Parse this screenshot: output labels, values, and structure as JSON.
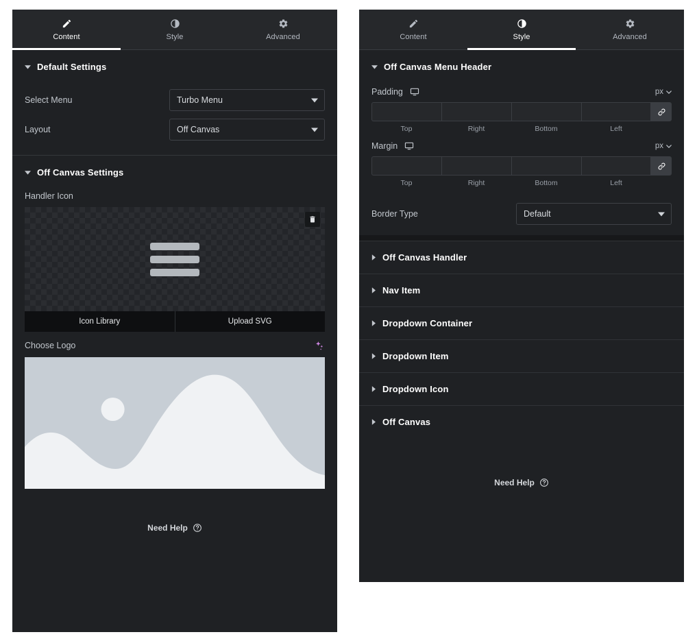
{
  "theme": {
    "panel_bg": "#1f2124",
    "tabbar_bg": "#26282b",
    "accent": "#ffffff",
    "label_color": "#c2c7cd",
    "ai_icon_color": "#d48ae8",
    "placeholder_bg": "#c7ced5",
    "placeholder_fg": "#f0f2f4",
    "burger_color": "#b3b8bd"
  },
  "content_panel": {
    "tabs": [
      {
        "label": "Content",
        "icon": "pencil-icon",
        "active": true
      },
      {
        "label": "Style",
        "icon": "contrast-icon",
        "active": false
      },
      {
        "label": "Advanced",
        "icon": "gear-icon",
        "active": false
      }
    ],
    "sections": [
      {
        "title": "Default Settings",
        "expanded": true,
        "rows": [
          {
            "label": "Select Menu",
            "control": "select",
            "value": "Turbo Menu"
          },
          {
            "label": "Layout",
            "control": "select",
            "value": "Off Canvas"
          }
        ]
      },
      {
        "title": "Off Canvas Settings",
        "expanded": true
      }
    ],
    "handler_icon": {
      "label": "Handler Icon",
      "delete_icon": "trash-icon",
      "preview": "hamburger-bars",
      "buttons": [
        {
          "label": "Icon Library"
        },
        {
          "label": "Upload SVG"
        }
      ]
    },
    "choose_logo": {
      "label": "Choose Logo",
      "ai_icon": "sparkle-ai-icon",
      "preview": "image-placeholder"
    },
    "need_help": {
      "label": "Need Help",
      "icon": "question-circle-icon"
    }
  },
  "style_panel": {
    "tabs": [
      {
        "label": "Content",
        "icon": "pencil-icon",
        "active": false
      },
      {
        "label": "Style",
        "icon": "contrast-icon",
        "active": true
      },
      {
        "label": "Advanced",
        "icon": "gear-icon",
        "active": false
      }
    ],
    "open_section": {
      "title": "Off Canvas Menu Header",
      "dimension_controls": [
        {
          "label": "Padding",
          "device_icon": "desktop-icon",
          "unit": "px",
          "unit_caret": "chevron-down-icon",
          "linked": true,
          "link_icon": "link-icon",
          "sides": [
            {
              "name": "Top",
              "value": ""
            },
            {
              "name": "Right",
              "value": ""
            },
            {
              "name": "Bottom",
              "value": ""
            },
            {
              "name": "Left",
              "value": ""
            }
          ]
        },
        {
          "label": "Margin",
          "device_icon": "desktop-icon",
          "unit": "px",
          "unit_caret": "chevron-down-icon",
          "linked": true,
          "link_icon": "link-icon",
          "sides": [
            {
              "name": "Top",
              "value": ""
            },
            {
              "name": "Right",
              "value": ""
            },
            {
              "name": "Bottom",
              "value": ""
            },
            {
              "name": "Left",
              "value": ""
            }
          ]
        }
      ],
      "border_type": {
        "label": "Border Type",
        "value": "Default"
      }
    },
    "collapsed_sections": [
      {
        "title": "Off Canvas Handler"
      },
      {
        "title": "Nav Item"
      },
      {
        "title": "Dropdown Container"
      },
      {
        "title": "Dropdown Item"
      },
      {
        "title": "Dropdown Icon"
      },
      {
        "title": "Off Canvas"
      }
    ],
    "need_help": {
      "label": "Need Help",
      "icon": "question-circle-icon"
    }
  }
}
